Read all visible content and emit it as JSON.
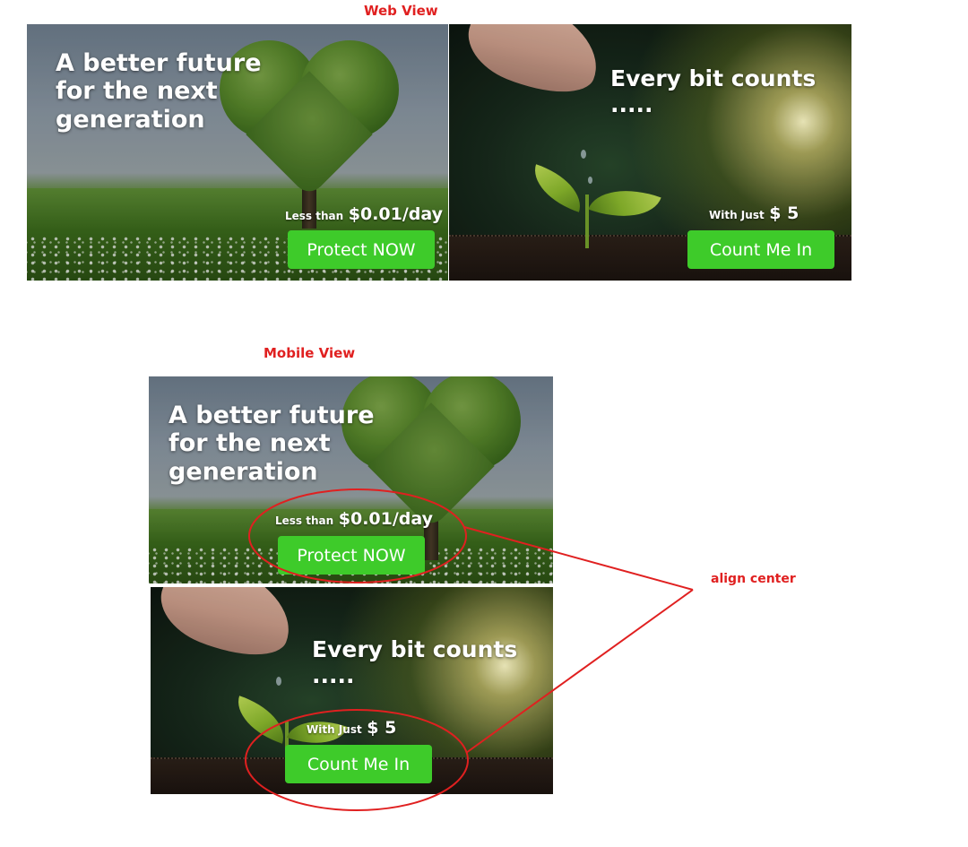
{
  "web_view": {
    "label": "Web View",
    "banner_left": {
      "headline": [
        "A better future",
        "for the next",
        "generation"
      ],
      "price_prefix": "Less than",
      "price_value": "$0.01/day",
      "button_label": "Protect NOW"
    },
    "banner_right": {
      "headline": "Every bit counts .....",
      "price_prefix": "With Just",
      "price_value": "$ 5",
      "button_label": "Count Me In"
    }
  },
  "mobile_view": {
    "label": "Mobile View",
    "banner_top": {
      "headline": [
        "A better future",
        "for the next",
        "generation"
      ],
      "price_prefix": "Less than",
      "price_value": "$0.01/day",
      "button_label": "Protect NOW"
    },
    "banner_bottom": {
      "headline": "Every bit counts .....",
      "price_prefix": "With Just",
      "price_value": "$ 5",
      "button_label": "Count Me In"
    }
  },
  "annotation": {
    "label": "align center",
    "color": "#e02020"
  },
  "colors": {
    "button_green": "#3ecb2a",
    "label_red": "#e02020"
  }
}
